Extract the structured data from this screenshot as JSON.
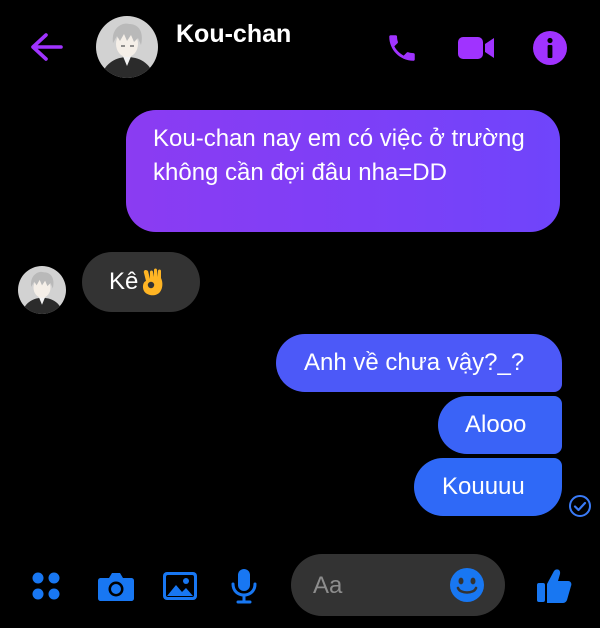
{
  "header": {
    "contact_name": "Kou-chan",
    "icons": [
      "back-arrow-icon",
      "phone-icon",
      "video-camera-icon",
      "info-icon"
    ]
  },
  "messages": [
    {
      "from": "me",
      "text": " Kou-chan nay em có việc ở trường không cần đợi đâu nha=DD"
    },
    {
      "from": "them",
      "text": "Kê",
      "emoji": "ok-hand"
    },
    {
      "from": "me",
      "text": "Anh về chưa vậy?_?"
    },
    {
      "from": "me",
      "text": "Alooo"
    },
    {
      "from": "me",
      "text": "Kouuuu"
    }
  ],
  "composer": {
    "placeholder": "Aa",
    "tools": [
      "apps-grid-icon",
      "camera-icon",
      "gallery-icon",
      "microphone-icon"
    ],
    "emoji_icon": "smiley-icon",
    "like_icon": "thumbs-up-icon"
  },
  "colors": {
    "background": "#000000",
    "accent": "#a033ff",
    "tool_blue": "#1877f2",
    "bubble_gradient_start": "#8b3cf2",
    "bubble_gradient_end": "#2f69f7",
    "incoming_bubble": "#333333"
  }
}
